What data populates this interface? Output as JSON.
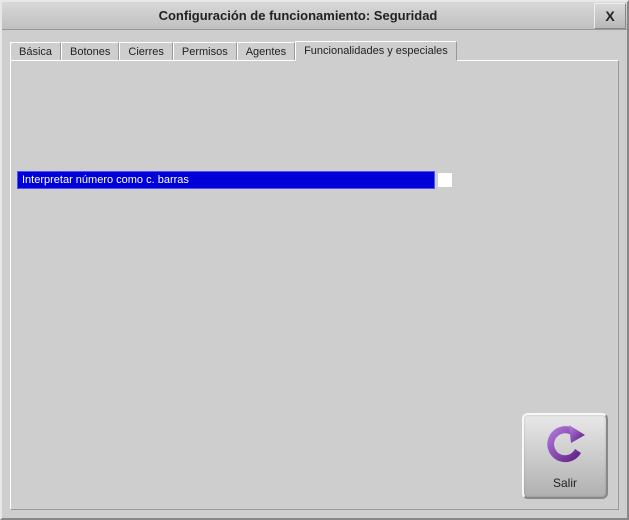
{
  "window": {
    "title": "Configuración de funcionamiento: Seguridad",
    "close_label": "X"
  },
  "tabs": [
    {
      "label": "Básica"
    },
    {
      "label": "Botones"
    },
    {
      "label": "Cierres"
    },
    {
      "label": "Permisos"
    },
    {
      "label": "Agentes"
    },
    {
      "label": "Funcionalidades y especiales"
    }
  ],
  "active_tab_index": 5,
  "option": {
    "label": "Interpretar número como c. barras",
    "checked": false
  },
  "exit": {
    "label": "Salir"
  },
  "colors": {
    "highlight_bg": "#0000d8",
    "highlight_fg": "#ffffff",
    "panel_bg": "#cecece",
    "arrow_icon": "#7a2fb5"
  }
}
